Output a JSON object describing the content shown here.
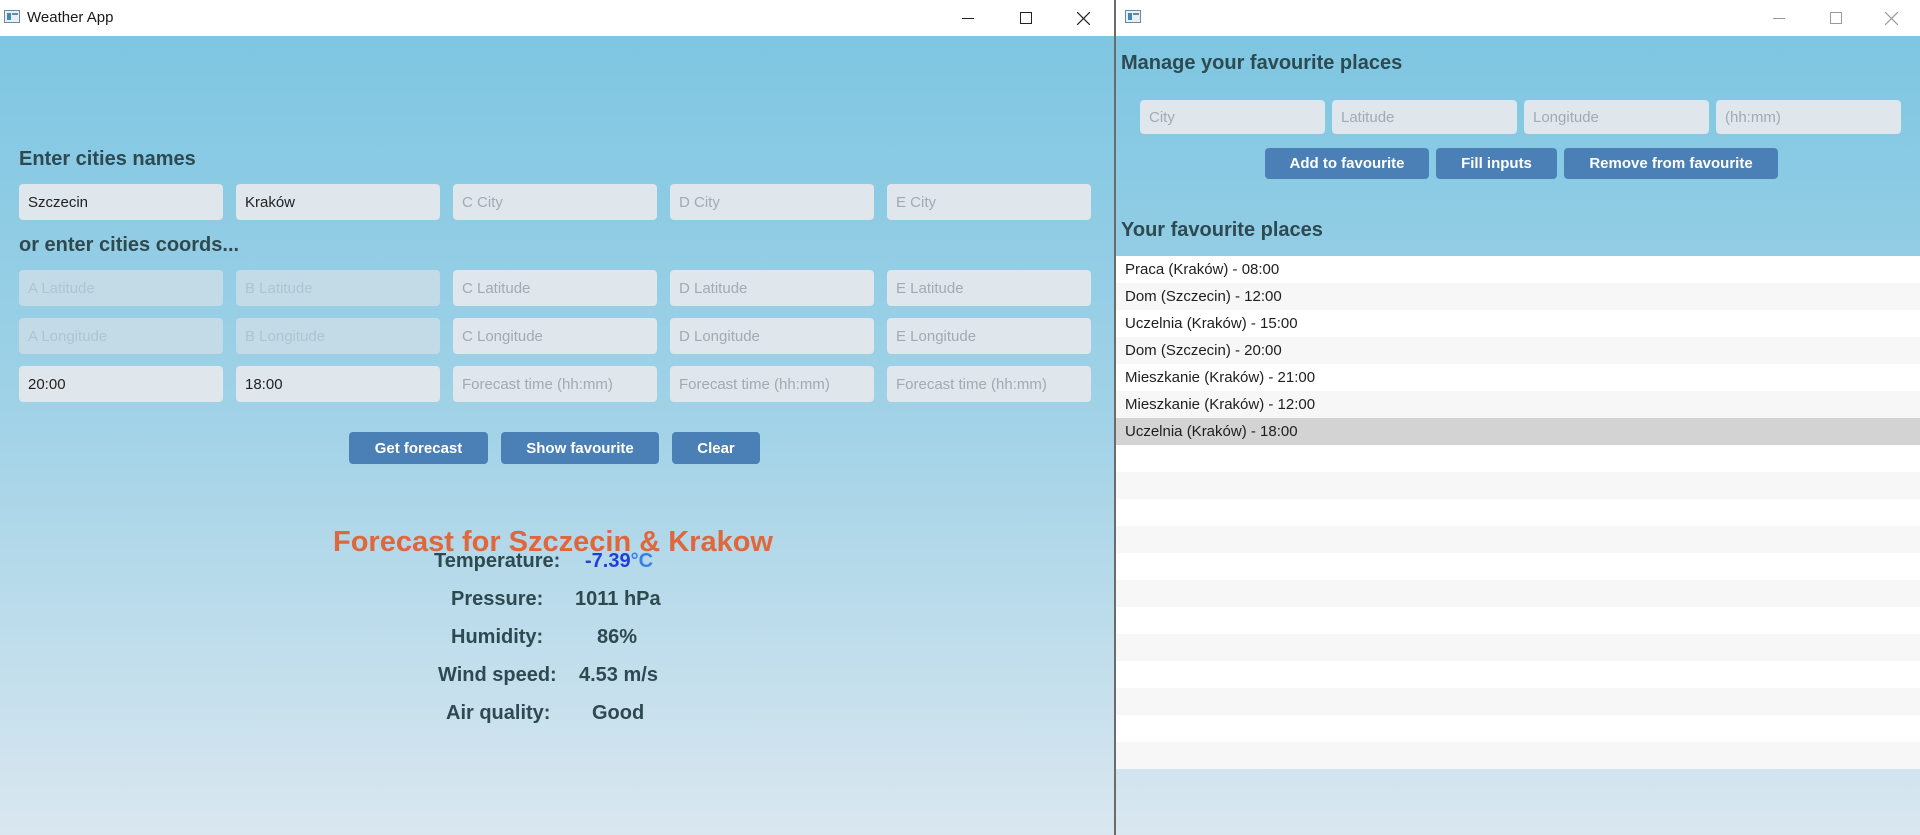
{
  "left_window": {
    "title": "Weather App",
    "cities_heading": "Enter cities names",
    "coords_heading": "or enter cities coords...",
    "cities": [
      {
        "value": "Szczecin",
        "placeholder": ""
      },
      {
        "value": "Kraków",
        "placeholder": ""
      },
      {
        "value": "",
        "placeholder": "C City"
      },
      {
        "value": "",
        "placeholder": "D City"
      },
      {
        "value": "",
        "placeholder": "E City"
      }
    ],
    "latitudes": [
      {
        "value": "",
        "placeholder": "A Latitude",
        "disabled": true
      },
      {
        "value": "",
        "placeholder": "B Latitude",
        "disabled": true
      },
      {
        "value": "",
        "placeholder": "C Latitude",
        "disabled": false
      },
      {
        "value": "",
        "placeholder": "D Latitude",
        "disabled": false
      },
      {
        "value": "",
        "placeholder": "E Latitude",
        "disabled": false
      }
    ],
    "longitudes": [
      {
        "value": "",
        "placeholder": "A Longitude",
        "disabled": true
      },
      {
        "value": "",
        "placeholder": "B Longitude",
        "disabled": true
      },
      {
        "value": "",
        "placeholder": "C Longitude",
        "disabled": false
      },
      {
        "value": "",
        "placeholder": "D Longitude",
        "disabled": false
      },
      {
        "value": "",
        "placeholder": "E Longitude",
        "disabled": false
      }
    ],
    "times": [
      {
        "value": "20:00",
        "placeholder": ""
      },
      {
        "value": "18:00",
        "placeholder": ""
      },
      {
        "value": "",
        "placeholder": "Forecast time (hh:mm)"
      },
      {
        "value": "",
        "placeholder": "Forecast time (hh:mm)"
      },
      {
        "value": "",
        "placeholder": "Forecast time (hh:mm)"
      }
    ],
    "buttons": {
      "get_forecast": "Get forecast",
      "show_favourite": "Show favourite",
      "clear": "Clear"
    },
    "forecast_title": "Forecast for Szczecin & Krakow",
    "stats": {
      "temperature_label": "Temperature:",
      "temperature_value": "-7.39",
      "temperature_unit": "°C",
      "pressure_label": "Pressure:",
      "pressure_value": "1011 hPa",
      "humidity_label": "Humidity:",
      "humidity_value": "86%",
      "wind_label": "Wind speed:",
      "wind_value": "4.53 m/s",
      "air_label": "Air quality:",
      "air_value": "Good"
    }
  },
  "right_window": {
    "title": "",
    "manage_heading": "Manage your favourite places",
    "inputs": {
      "city_placeholder": "City",
      "latitude_placeholder": "Latitude",
      "longitude_placeholder": "Longitude",
      "time_placeholder": "(hh:mm)"
    },
    "buttons": {
      "add": "Add to favourite",
      "fill": "Fill inputs",
      "remove": "Remove from favourite"
    },
    "list_heading": "Your favourite places",
    "favourites": [
      "Praca (Kraków) - 08:00",
      "Dom (Szczecin) - 12:00",
      "Uczelnia (Kraków) - 15:00",
      "Dom (Szczecin) - 20:00",
      "Mieszkanie (Kraków) - 21:00",
      "Mieszkanie (Kraków) - 12:00",
      "Uczelnia (Kraków) - 18:00"
    ],
    "selected_favourite": "Uczelnia (Kraków) - 18:00"
  },
  "icons": {
    "app": "app-window-icon",
    "minimize": "minimize-icon",
    "maximize": "maximize-icon",
    "close": "close-icon"
  },
  "colors": {
    "accent_button": "#4a80b6",
    "forecast_title": "#e0663c",
    "temperature": "#1f3fdd",
    "heading_text": "#2e4a50",
    "selected_row": "#d3d3d3"
  }
}
